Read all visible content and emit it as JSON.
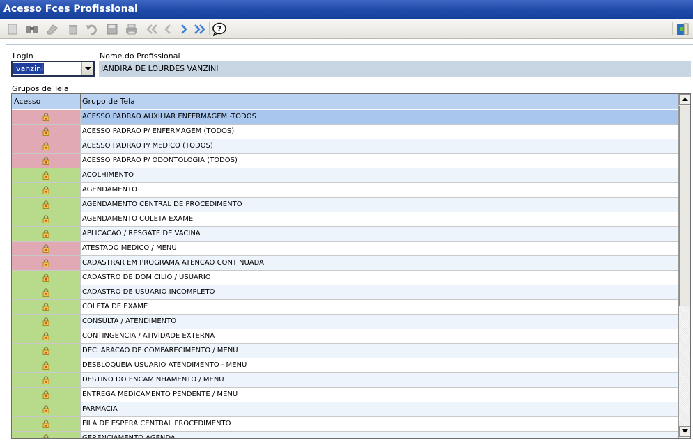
{
  "window": {
    "title": "Acesso Fces Profissional"
  },
  "toolbar": {
    "buttons": [
      {
        "icon": "new-icon"
      },
      {
        "icon": "binoculars-icon"
      },
      {
        "icon": "eraser-icon"
      },
      {
        "icon": "trash-icon"
      },
      {
        "icon": "undo-icon"
      },
      {
        "icon": "save-icon"
      },
      {
        "icon": "print-icon"
      },
      {
        "icon": "first-icon"
      },
      {
        "icon": "previous-icon"
      },
      {
        "icon": "next-icon"
      },
      {
        "icon": "last-icon"
      },
      {
        "icon": "help-icon"
      },
      {
        "icon": "exit-icon"
      }
    ]
  },
  "form": {
    "login_label": "Login",
    "login_value": "jvanzini",
    "name_label": "Nome do Profissional",
    "name_value": "JANDIRA DE LOURDES VANZINI",
    "groups_label": "Grupos de Tela"
  },
  "grid": {
    "col_access": "Acesso",
    "col_group": "Grupo de Tela",
    "colors": {
      "allowed": "#b7db8a",
      "denied": "#e0a9b4",
      "selected": "#a9c6ee"
    },
    "rows": [
      {
        "status": "denied",
        "group": "ACESSO PADRAO AUXILIAR ENFERMAGEM -TODOS",
        "selected": true
      },
      {
        "status": "denied",
        "group": "ACESSO PADRAO P/ ENFERMAGEM (TODOS)"
      },
      {
        "status": "denied",
        "group": "ACESSO PADRAO P/ MEDICO (TODOS)"
      },
      {
        "status": "denied",
        "group": "ACESSO PADRAO P/ ODONTOLOGIA (TODOS)"
      },
      {
        "status": "allowed",
        "group": "ACOLHIMENTO"
      },
      {
        "status": "allowed",
        "group": "AGENDAMENTO"
      },
      {
        "status": "allowed",
        "group": "AGENDAMENTO CENTRAL DE PROCEDIMENTO"
      },
      {
        "status": "allowed",
        "group": "AGENDAMENTO COLETA EXAME"
      },
      {
        "status": "allowed",
        "group": "APLICACAO / RESGATE DE VACINA"
      },
      {
        "status": "denied",
        "group": "ATESTADO MEDICO / MENU"
      },
      {
        "status": "denied",
        "group": "CADASTRAR EM PROGRAMA ATENCAO CONTINUADA"
      },
      {
        "status": "allowed",
        "group": "CADASTRO DE DOMICILIO / USUARIO"
      },
      {
        "status": "allowed",
        "group": "CADASTRO DE USUARIO INCOMPLETO"
      },
      {
        "status": "allowed",
        "group": "COLETA DE EXAME"
      },
      {
        "status": "allowed",
        "group": "CONSULTA / ATENDIMENTO"
      },
      {
        "status": "allowed",
        "group": "CONTINGENCIA / ATIVIDADE EXTERNA"
      },
      {
        "status": "allowed",
        "group": "DECLARACAO DE COMPARECIMENTO / MENU"
      },
      {
        "status": "allowed",
        "group": "DESBLOQUEIA USUARIO ATENDIMENTO - MENU"
      },
      {
        "status": "allowed",
        "group": "DESTINO DO ENCAMINHAMENTO / MENU"
      },
      {
        "status": "allowed",
        "group": "ENTREGA MEDICAMENTO PENDENTE / MENU"
      },
      {
        "status": "allowed",
        "group": "FARMACIA"
      },
      {
        "status": "allowed",
        "group": "FILA DE ESPERA CENTRAL PROCEDIMENTO"
      },
      {
        "status": "allowed",
        "group": "GERENCIAMENTO AGENDA"
      }
    ]
  }
}
